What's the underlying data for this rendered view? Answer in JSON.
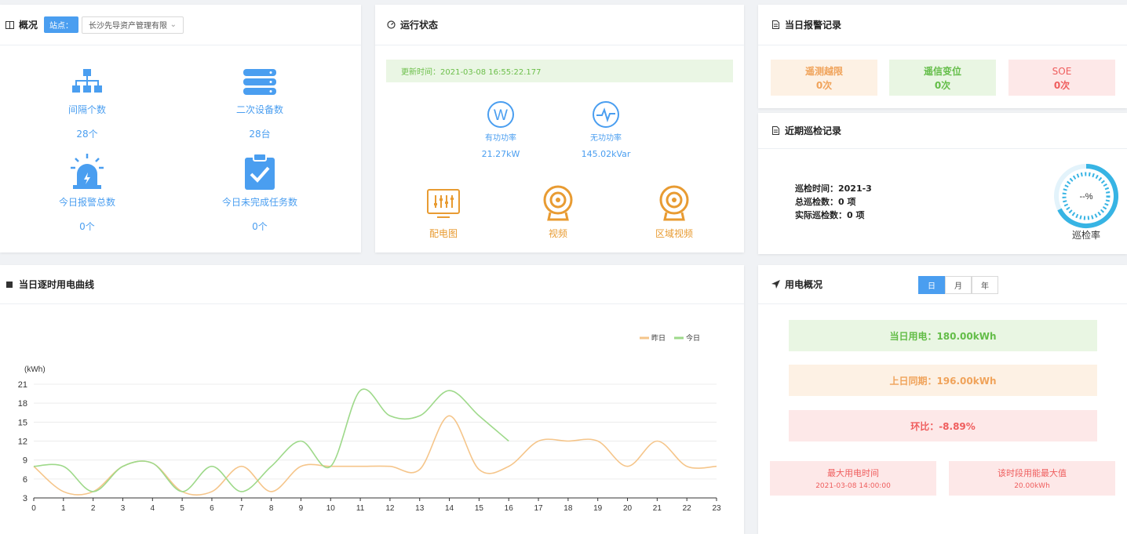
{
  "overview": {
    "title": "概况",
    "station_label": "站点：",
    "station_value": "长沙先导资产管理有限",
    "stats": [
      {
        "label": "间隔个数",
        "value": "28个"
      },
      {
        "label": "二次设备数",
        "value": "28台"
      },
      {
        "label": "今日报警总数",
        "value": "0个"
      },
      {
        "label": "今日未完成任务数",
        "value": "0个"
      }
    ]
  },
  "running": {
    "title": "运行状态",
    "update_time": "更新时间：2021-03-08 16:55:22.177",
    "active_power": {
      "label": "有功功率",
      "value": "21.27kW"
    },
    "reactive_power": {
      "label": "无功功率",
      "value": "145.02kVar"
    },
    "links": [
      "配电图",
      "视频",
      "区域视频"
    ]
  },
  "alarm": {
    "title": "当日报警记录",
    "items": [
      {
        "label": "遥测越限",
        "value": "0次"
      },
      {
        "label": "遥信变位",
        "value": "0次"
      },
      {
        "label": "SOE",
        "value": "0次"
      }
    ]
  },
  "patrol": {
    "title": "近期巡检记录",
    "time": "巡检时间：2021-3",
    "total": "总巡检数：0 项",
    "actual": "实际巡检数：0 项",
    "gauge_value": "--%",
    "gauge_label": "巡检率"
  },
  "curve": {
    "title": "当日逐时用电曲线"
  },
  "usage": {
    "title": "用电概况",
    "tabs": [
      "日",
      "月",
      "年"
    ],
    "today": "当日用电：180.00kWh",
    "lastday": "上日同期：196.00kWh",
    "ratio": "环比：-8.89%",
    "max_time_label": "最大用电时间",
    "max_time_value": "2021-03-08 14:00:00",
    "max_value_label": "该时段用能最大值",
    "max_value_value": "20.00kWh"
  },
  "colors": {
    "accent": "#4a9ef0",
    "yesterday": "#f5c58a",
    "today": "#9ed98a"
  },
  "chart_data": {
    "type": "line",
    "title": "",
    "xlabel": "",
    "ylabel": "(kWh)",
    "x": [
      0,
      1,
      2,
      3,
      4,
      5,
      6,
      7,
      8,
      9,
      10,
      11,
      12,
      13,
      14,
      15,
      16,
      17,
      18,
      19,
      20,
      21,
      22,
      23
    ],
    "ylim": [
      3,
      21
    ],
    "yticks": [
      3,
      6,
      9,
      12,
      15,
      18,
      21
    ],
    "legend_position": "top-right",
    "series": [
      {
        "name": "昨日",
        "color": "#f5c58a",
        "values": [
          8,
          4,
          4,
          8,
          8.5,
          4,
          4,
          8,
          4,
          8,
          8,
          8,
          8,
          7.5,
          16,
          7.5,
          8,
          12,
          12,
          12,
          8,
          12,
          8,
          8
        ]
      },
      {
        "name": "今日",
        "color": "#9ed98a",
        "values": [
          8,
          8,
          4,
          8,
          8.5,
          4,
          8,
          4,
          8,
          12,
          8,
          20,
          16,
          16,
          20,
          16,
          12
        ]
      }
    ]
  }
}
